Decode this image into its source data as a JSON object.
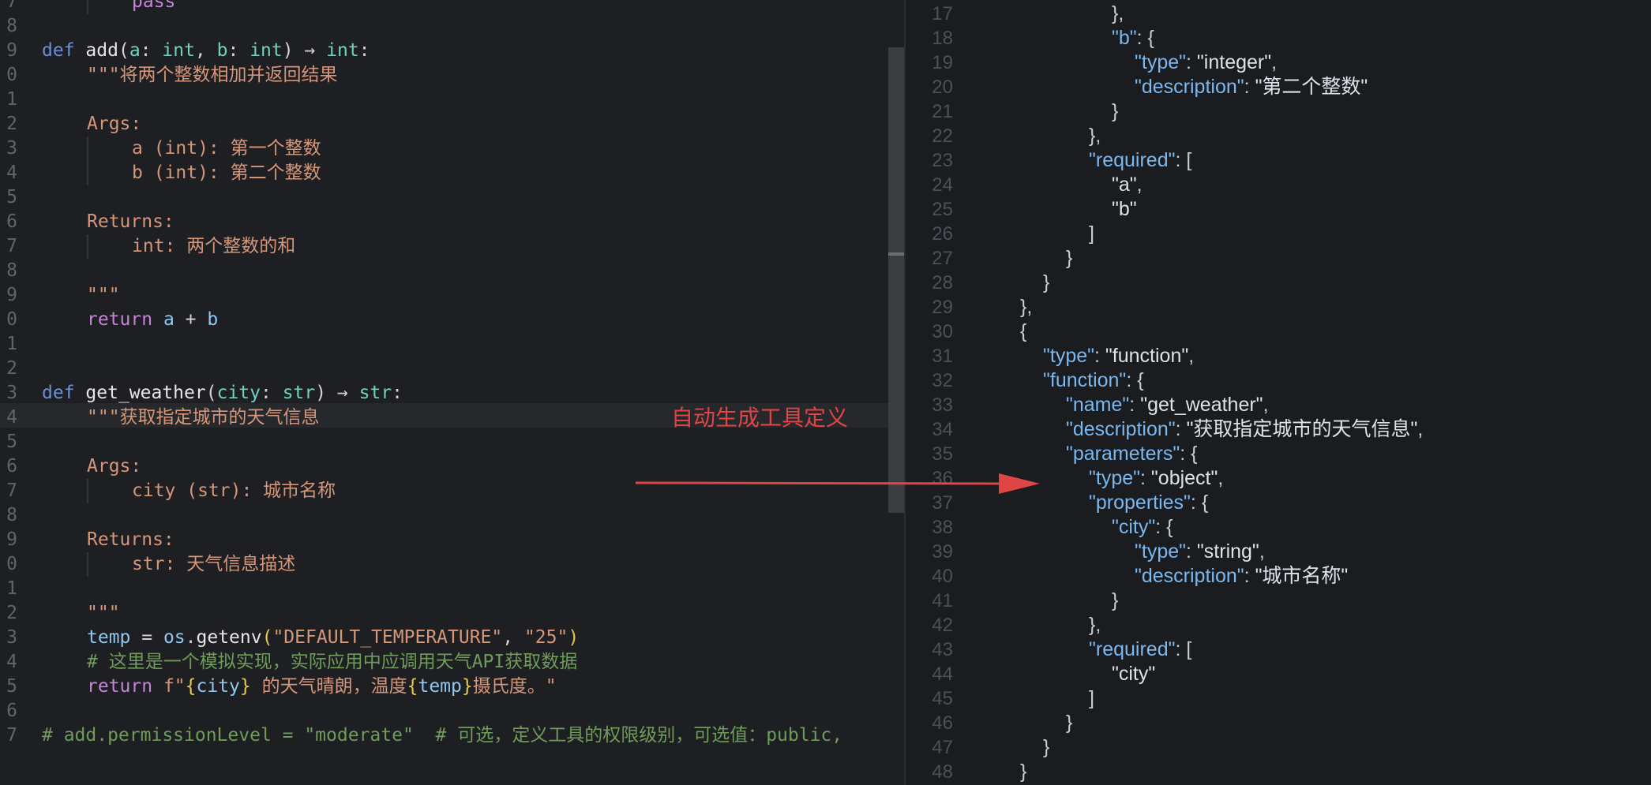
{
  "annotation": "自动生成工具定义",
  "left_lines": [
    {
      "n": "7",
      "html": "<span class=\"ret\">pass</span>",
      "indent": 2
    },
    {
      "n": "8",
      "html": "",
      "indent": 0
    },
    {
      "n": "9",
      "html": "<span class=\"kw\">def</span> <span class=\"fn\">add</span>(<span class=\"param\">a</span>: <span class=\"type\">int</span>, <span class=\"param\">b</span>: <span class=\"type\">int</span>) → <span class=\"type\">int</span>:",
      "indent": 0
    },
    {
      "n": "0",
      "html": "<span class=\"doc\">\"\"\"将两个整数相加并返回结果</span>",
      "indent": 1
    },
    {
      "n": "1",
      "html": "",
      "indent": 0
    },
    {
      "n": "2",
      "html": "<span class=\"doc\">Args:</span>",
      "indent": 1
    },
    {
      "n": "3",
      "html": "<span class=\"doc\">a (int): 第一个整数</span>",
      "indent": 2
    },
    {
      "n": "4",
      "html": "<span class=\"doc\">b (int): 第二个整数</span>",
      "indent": 2
    },
    {
      "n": "5",
      "html": "",
      "indent": 0
    },
    {
      "n": "6",
      "html": "<span class=\"doc\">Returns:</span>",
      "indent": 1
    },
    {
      "n": "7",
      "html": "<span class=\"doc\">int: 两个整数的和</span>",
      "indent": 2
    },
    {
      "n": "8",
      "html": "",
      "indent": 0
    },
    {
      "n": "9",
      "html": "<span class=\"doc\">\"\"\"</span>",
      "indent": 1
    },
    {
      "n": "0",
      "html": "<span class=\"ret\">return</span> <span class=\"var\">a</span> + <span class=\"var\">b</span>",
      "indent": 1
    },
    {
      "n": "1",
      "html": "",
      "indent": 0
    },
    {
      "n": "2",
      "html": "",
      "indent": 0
    },
    {
      "n": "3",
      "html": "<span class=\"kw\">def</span> <span class=\"fn\">get_weather</span>(<span class=\"param\">city</span>: <span class=\"type\">str</span>) → <span class=\"type\">str</span>:",
      "indent": 0
    },
    {
      "n": "4",
      "html": "<span class=\"doc\">\"\"\"获取指定城市的天气信息</span>",
      "indent": 1
    },
    {
      "n": "5",
      "html": "",
      "indent": 0
    },
    {
      "n": "6",
      "html": "<span class=\"doc\">Args:</span>",
      "indent": 1
    },
    {
      "n": "7",
      "html": "<span class=\"doc\">city (str): 城市名称</span>",
      "indent": 2
    },
    {
      "n": "8",
      "html": "",
      "indent": 0
    },
    {
      "n": "9",
      "html": "<span class=\"doc\">Returns:</span>",
      "indent": 1
    },
    {
      "n": "0",
      "html": "<span class=\"doc\">str: 天气信息描述</span>",
      "indent": 2
    },
    {
      "n": "1",
      "html": "",
      "indent": 0
    },
    {
      "n": "2",
      "html": "<span class=\"doc\">\"\"\"</span>",
      "indent": 1
    },
    {
      "n": "3",
      "html": "<span class=\"var\">temp</span> = <span class=\"var\">os</span>.<span class=\"fn\">getenv</span><span class=\"brace\">(</span><span class=\"str\">\"DEFAULT_TEMPERATURE\"</span>, <span class=\"str\">\"25\"</span><span class=\"brace\">)</span>",
      "indent": 1
    },
    {
      "n": "4",
      "html": "<span class=\"cmt\"># 这里是一个模拟实现，实际应用中应调用天气API获取数据</span>",
      "indent": 1
    },
    {
      "n": "5",
      "html": "<span class=\"ret\">return</span> <span class=\"str\">f\"</span><span class=\"brace\">{</span><span class=\"var\">city</span><span class=\"brace\">}</span><span class=\"str\"> 的天气晴朗，温度</span><span class=\"brace\">{</span><span class=\"var\">temp</span><span class=\"brace\">}</span><span class=\"str\">摄氏度。\"</span>",
      "indent": 1
    },
    {
      "n": "6",
      "html": "",
      "indent": 0
    },
    {
      "n": "7",
      "html": "<span class=\"cmt\"># add.permissionLevel = \"moderate\"  # 可选，定义工具的权限级别，可选值：public,</span>",
      "indent": 0
    }
  ],
  "right_lines": [
    {
      "n": "17",
      "indent": 4,
      "html": "},"
    },
    {
      "n": "18",
      "indent": 4,
      "html": "<span class=\"jk\">\"b\"</span>: {"
    },
    {
      "n": "19",
      "indent": 5,
      "html": "<span class=\"jk\">\"type\"</span>: <span class=\"jv\">\"integer\"</span>,"
    },
    {
      "n": "20",
      "indent": 5,
      "html": "<span class=\"jk\">\"description\"</span>: <span class=\"jv\">\"第二个整数\"</span>"
    },
    {
      "n": "21",
      "indent": 4,
      "html": "}"
    },
    {
      "n": "22",
      "indent": 3,
      "html": "},"
    },
    {
      "n": "23",
      "indent": 3,
      "html": "<span class=\"jk\">\"required\"</span>: ["
    },
    {
      "n": "24",
      "indent": 4,
      "html": "<span class=\"jv\">\"a\"</span>,"
    },
    {
      "n": "25",
      "indent": 4,
      "html": "<span class=\"jv\">\"b\"</span>"
    },
    {
      "n": "26",
      "indent": 3,
      "html": "]"
    },
    {
      "n": "27",
      "indent": 2,
      "html": "}"
    },
    {
      "n": "28",
      "indent": 1,
      "html": "}"
    },
    {
      "n": "29",
      "indent": 0,
      "html": "},"
    },
    {
      "n": "30",
      "indent": 0,
      "html": "{"
    },
    {
      "n": "31",
      "indent": 1,
      "html": "<span class=\"jk\">\"type\"</span>: <span class=\"jv\">\"function\"</span>,"
    },
    {
      "n": "32",
      "indent": 1,
      "html": "<span class=\"jk\">\"function\"</span>: {"
    },
    {
      "n": "33",
      "indent": 2,
      "html": "<span class=\"jk\">\"name\"</span>: <span class=\"jv\">\"get_weather\"</span>,"
    },
    {
      "n": "34",
      "indent": 2,
      "html": "<span class=\"jk\">\"description\"</span>: <span class=\"jv\">\"获取指定城市的天气信息\"</span>,"
    },
    {
      "n": "35",
      "indent": 2,
      "html": "<span class=\"jk\">\"parameters\"</span>: {"
    },
    {
      "n": "36",
      "indent": 3,
      "html": "<span class=\"jk\">\"type\"</span>: <span class=\"jv\">\"object\"</span>,"
    },
    {
      "n": "37",
      "indent": 3,
      "html": "<span class=\"jk\">\"properties\"</span>: {"
    },
    {
      "n": "38",
      "indent": 4,
      "html": "<span class=\"jk\">\"city\"</span>: {"
    },
    {
      "n": "39",
      "indent": 5,
      "html": "<span class=\"jk\">\"type\"</span>: <span class=\"jv\">\"string\"</span>,"
    },
    {
      "n": "40",
      "indent": 5,
      "html": "<span class=\"jk\">\"description\"</span>: <span class=\"jv\">\"城市名称\"</span>"
    },
    {
      "n": "41",
      "indent": 4,
      "html": "}"
    },
    {
      "n": "42",
      "indent": 3,
      "html": "},"
    },
    {
      "n": "43",
      "indent": 3,
      "html": "<span class=\"jk\">\"required\"</span>: ["
    },
    {
      "n": "44",
      "indent": 4,
      "html": "<span class=\"jv\">\"city\"</span>"
    },
    {
      "n": "45",
      "indent": 3,
      "html": "]"
    },
    {
      "n": "46",
      "indent": 2,
      "html": "}"
    },
    {
      "n": "47",
      "indent": 1,
      "html": "}"
    },
    {
      "n": "48",
      "indent": 0,
      "html": "}"
    }
  ]
}
